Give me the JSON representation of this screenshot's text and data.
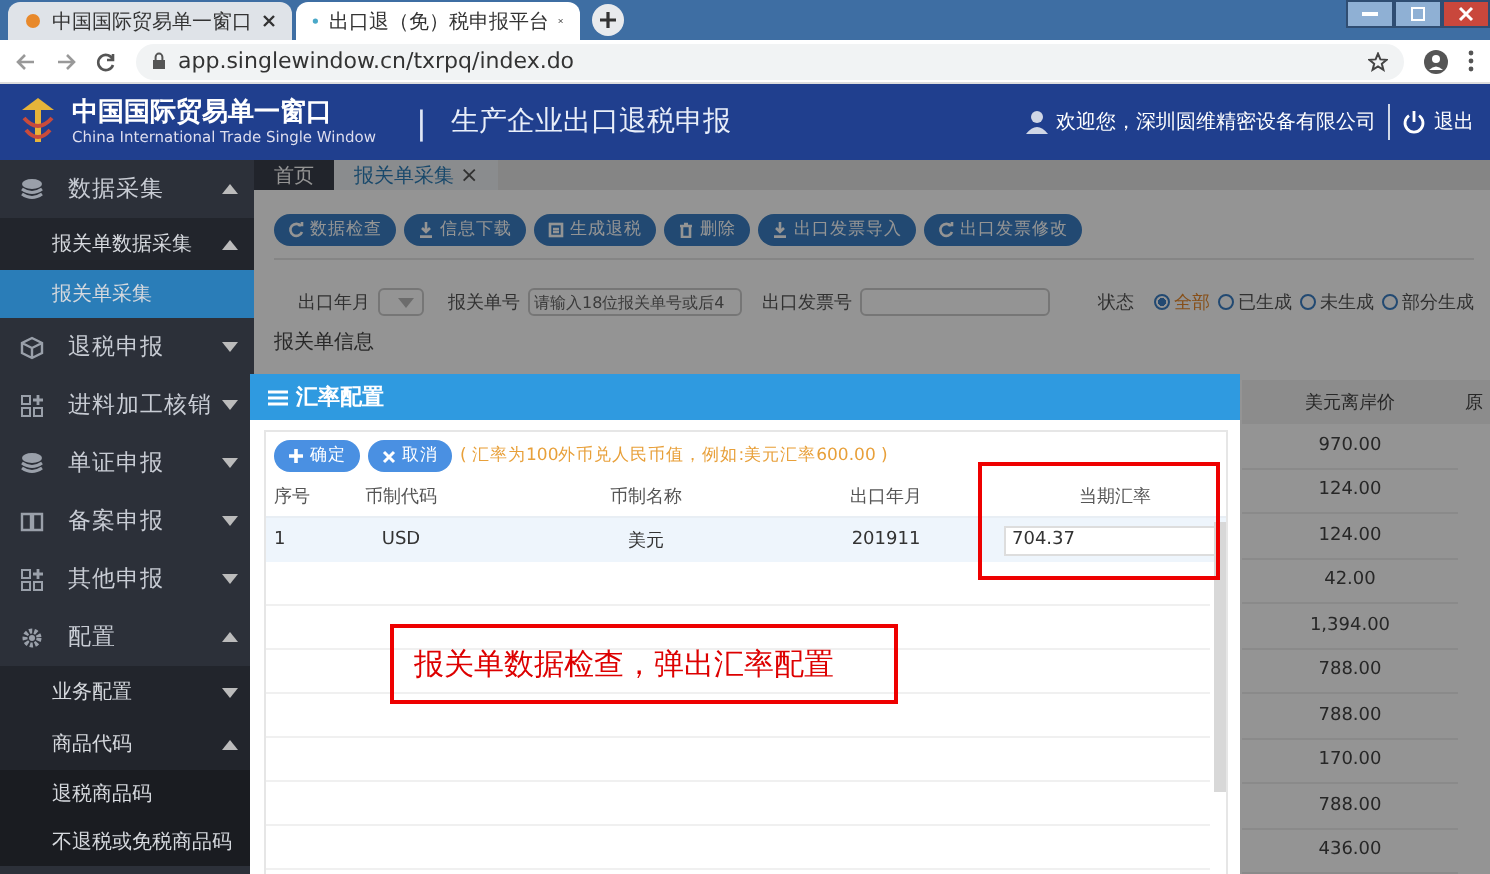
{
  "browser": {
    "tabs": [
      {
        "label": "中国国际贸易单一窗口",
        "selected": false
      },
      {
        "label": "出口退（免）税申报平台",
        "selected": true
      }
    ],
    "url": "app.singlewindow.cn/txrpq/index.do"
  },
  "header": {
    "logo_cn": "中国国际贸易单一窗口",
    "logo_en": "China International Trade Single Window",
    "separator": "|",
    "system_title": "生产企业出口退税申报",
    "welcome": "欢迎您，深圳圆维精密设备有限公司",
    "logout": "退出"
  },
  "sidebar": {
    "items": [
      {
        "label": "数据采集",
        "kind": "stack",
        "expanded": true,
        "selected": false,
        "children": [
          {
            "label": "报关单数据采集",
            "expanded": true,
            "selected": false,
            "children": [
              {
                "label": "报关单采集",
                "selected": true
              }
            ]
          }
        ]
      },
      {
        "label": "退税申报",
        "kind": "cube",
        "expanded": false,
        "selected": false
      },
      {
        "label": "进料加工核销",
        "kind": "grid",
        "expanded": false,
        "selected": false
      },
      {
        "label": "单证申报",
        "kind": "stack",
        "expanded": false,
        "selected": false
      },
      {
        "label": "备案申报",
        "kind": "book",
        "expanded": false,
        "selected": false
      },
      {
        "label": "其他申报",
        "kind": "grid",
        "expanded": false,
        "selected": false
      },
      {
        "label": "配置",
        "kind": "gear",
        "expanded": true,
        "selected": false,
        "children": [
          {
            "label": "业务配置",
            "expanded": false,
            "selected": false
          },
          {
            "label": "商品代码",
            "expanded": true,
            "selected": false,
            "children": [
              {
                "label": "退税商品码",
                "selected": false
              },
              {
                "label": "不退税或免税商品码",
                "selected": false
              }
            ]
          }
        ]
      }
    ]
  },
  "page_tabs": [
    {
      "label": "首页",
      "selected": false
    },
    {
      "label": "报关单采集",
      "selected": true,
      "close": "×"
    }
  ],
  "toolbar": [
    {
      "label": "数据检查",
      "kind": "refresh"
    },
    {
      "label": "信息下载",
      "kind": "download"
    },
    {
      "label": "生成退税",
      "kind": "doc"
    },
    {
      "label": "删除",
      "kind": "trash"
    },
    {
      "label": "出口发票导入",
      "kind": "download"
    },
    {
      "label": "出口发票修改",
      "kind": "refresh"
    }
  ],
  "filters": {
    "export_month": {
      "label": "出口年月"
    },
    "declaration_no": {
      "label": "报关单号",
      "placeholder": "请输入18位报关单号或后4"
    },
    "invoice_no": {
      "label": "出口发票号"
    },
    "status": {
      "label": "状态",
      "options": [
        {
          "label": "全部",
          "selected": true
        },
        {
          "label": "已生成",
          "selected": false
        },
        {
          "label": "未生成",
          "selected": false
        },
        {
          "label": "部分生成",
          "selected": false
        }
      ]
    }
  },
  "section_title": "报关单信息",
  "background_table": {
    "columns": [
      "美元离岸价",
      "原"
    ],
    "rows": [
      "970.00",
      "124.00",
      "124.00",
      "42.00",
      "1,394.00",
      "788.00",
      "788.00",
      "170.00",
      "788.00",
      "436.00"
    ]
  },
  "dialog": {
    "title": "汇率配置",
    "buttons": [
      {
        "label": "确定",
        "kind": "plus"
      },
      {
        "label": "取消",
        "kind": "x"
      }
    ],
    "note": "( 汇率为100外币兑人民币值，例如:美元汇率600.00 )",
    "columns": [
      "序号",
      "币制代码",
      "币制名称",
      "出口年月",
      "当期汇率"
    ],
    "rows": [
      {
        "index": "1",
        "code": "USD",
        "name": "美元",
        "month": "201911",
        "rate": "704.37"
      }
    ]
  },
  "annotation": {
    "text": "报关单数据检查，弹出汇率配置"
  }
}
